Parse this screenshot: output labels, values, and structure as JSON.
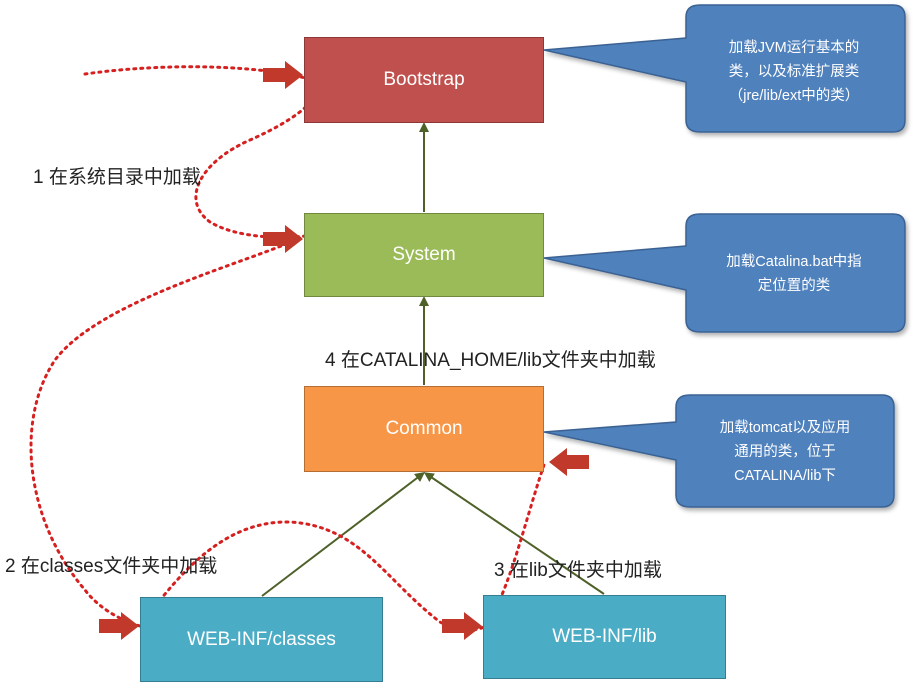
{
  "boxes": {
    "bootstrap": "Bootstrap",
    "system": "System",
    "common": "Common",
    "webinf_classes": "WEB-INF/classes",
    "webinf_lib": "WEB-INF/lib"
  },
  "callouts": {
    "bootstrap": [
      "加载JVM运行基本的",
      "类，以及标准扩展类",
      "（jre/lib/ext中的类）"
    ],
    "system": [
      "加载Catalina.bat中指",
      "定位置的类"
    ],
    "common": [
      "加载tomcat以及应用",
      "通用的类，位于",
      "CATALINA/lib下"
    ]
  },
  "labels": {
    "step1": "1 在系统目录中加载",
    "step2": "2 在classes文件夹中加载",
    "step3": "3 在lib文件夹中加载",
    "step4": "4 在CATALINA_HOME/lib文件夹中加载"
  },
  "colors": {
    "bootstrap": "#c0504d",
    "system": "#9bbb59",
    "common": "#f79646",
    "webinf": "#4bacc6",
    "callout": "#4f81bd",
    "connector": "#4e6128",
    "dotted_path": "#d62020",
    "pointer_arrow": "#c0392b"
  }
}
